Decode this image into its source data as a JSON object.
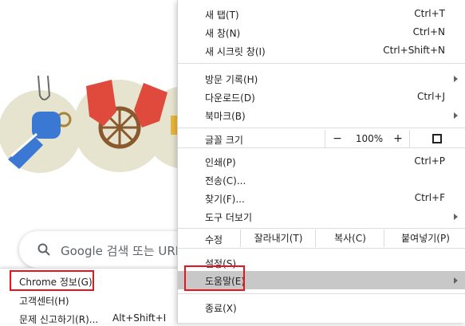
{
  "background": {
    "search_placeholder": "Google 검색 또는 URL 입력"
  },
  "help_submenu": {
    "items": [
      {
        "label": "Chrome 정보(G)",
        "shortcut": ""
      },
      {
        "label": "고객센터(H)",
        "shortcut": ""
      },
      {
        "label": "문제 신고하기(R)...",
        "shortcut": "Alt+Shift+I"
      }
    ]
  },
  "menu": {
    "new_tab": {
      "label": "새 탭(T)",
      "shortcut": "Ctrl+T"
    },
    "new_window": {
      "label": "새 창(N)",
      "shortcut": "Ctrl+N"
    },
    "new_incognito": {
      "label": "새 시크릿 창(I)",
      "shortcut": "Ctrl+Shift+N"
    },
    "history": {
      "label": "방문 기록(H)"
    },
    "downloads": {
      "label": "다운로드(D)",
      "shortcut": "Ctrl+J"
    },
    "bookmarks": {
      "label": "북마크(B)"
    },
    "zoom": {
      "label": "글꼴 크기",
      "minus": "−",
      "value": "100%",
      "plus": "+"
    },
    "print": {
      "label": "인쇄(P)",
      "shortcut": "Ctrl+P"
    },
    "cast": {
      "label": "전송(C)..."
    },
    "find": {
      "label": "찾기(F)...",
      "shortcut": "Ctrl+F"
    },
    "more_tools": {
      "label": "도구 더보기"
    },
    "edit": {
      "label": "수정",
      "cut": "잘라내기(T)",
      "copy": "복사(C)",
      "paste": "붙여넣기(P)"
    },
    "settings": {
      "label": "설정(S)"
    },
    "help": {
      "label": "도움말(E)"
    },
    "exit": {
      "label": "종료(X)"
    }
  },
  "colors": {
    "highlight": "#e8131b",
    "hover": "#c8c8c8"
  }
}
